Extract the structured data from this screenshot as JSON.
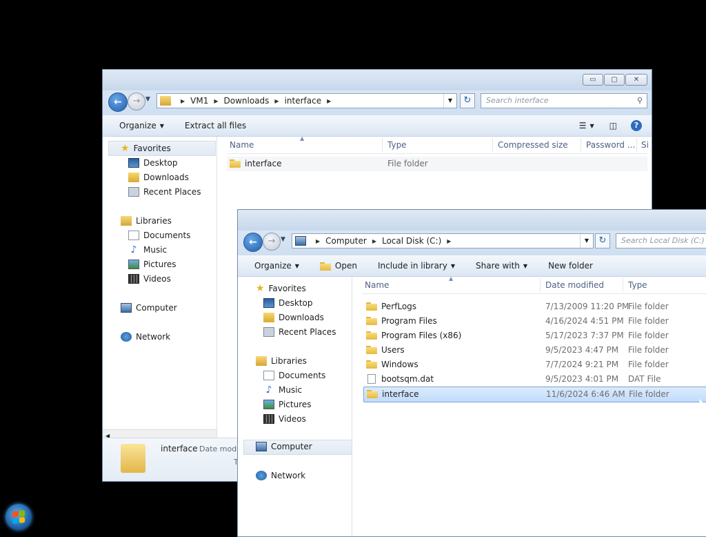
{
  "back_window": {
    "breadcrumbs": [
      "VM1",
      "Downloads",
      "interface"
    ],
    "search_placeholder": "Search interface",
    "commands": [
      {
        "label": "Organize",
        "has_arrow": true
      },
      {
        "label": "Extract all files",
        "has_arrow": false
      }
    ],
    "columns": [
      "Name",
      "Type",
      "Compressed size",
      "Password ...",
      "Si"
    ],
    "rows": [
      {
        "name": "interface",
        "type": "File folder"
      }
    ],
    "details": {
      "name": "interface",
      "label_fragment": "Date modi",
      "type_fragment": "T"
    }
  },
  "front_window": {
    "breadcrumbs": [
      "Computer",
      "Local Disk (C:)"
    ],
    "search_placeholder": "Search Local Disk (C:)",
    "commands": [
      {
        "label": "Organize",
        "has_arrow": true
      },
      {
        "label": "Open",
        "has_arrow": false
      },
      {
        "label": "Include in library",
        "has_arrow": true
      },
      {
        "label": "Share with",
        "has_arrow": true
      },
      {
        "label": "New folder",
        "has_arrow": false
      }
    ],
    "columns": [
      "Name",
      "Date modified",
      "Type"
    ],
    "rows": [
      {
        "name": "PerfLogs",
        "date": "7/13/2009 11:20 PM",
        "type": "File folder",
        "kind": "folder"
      },
      {
        "name": "Program Files",
        "date": "4/16/2024 4:51 PM",
        "type": "File folder",
        "kind": "folder"
      },
      {
        "name": "Program Files (x86)",
        "date": "5/17/2023 7:37 PM",
        "type": "File folder",
        "kind": "folder"
      },
      {
        "name": "Users",
        "date": "9/5/2023 4:47 PM",
        "type": "File folder",
        "kind": "folder"
      },
      {
        "name": "Windows",
        "date": "7/7/2024 9:21 PM",
        "type": "File folder",
        "kind": "folder"
      },
      {
        "name": "bootsqm.dat",
        "date": "9/5/2023 4:01 PM",
        "type": "DAT File",
        "kind": "file"
      },
      {
        "name": "interface",
        "date": "11/6/2024 6:46 AM",
        "type": "File folder",
        "kind": "folder",
        "selected": true
      }
    ]
  },
  "nav": {
    "favorites": "Favorites",
    "fav_items": [
      "Desktop",
      "Downloads",
      "Recent Places"
    ],
    "libraries": "Libraries",
    "lib_items": [
      "Documents",
      "Music",
      "Pictures",
      "Videos"
    ],
    "computer": "Computer",
    "network": "Network"
  },
  "caption_glyphs": {
    "minimize": "▭",
    "maximize": "▢",
    "close": "✕"
  }
}
